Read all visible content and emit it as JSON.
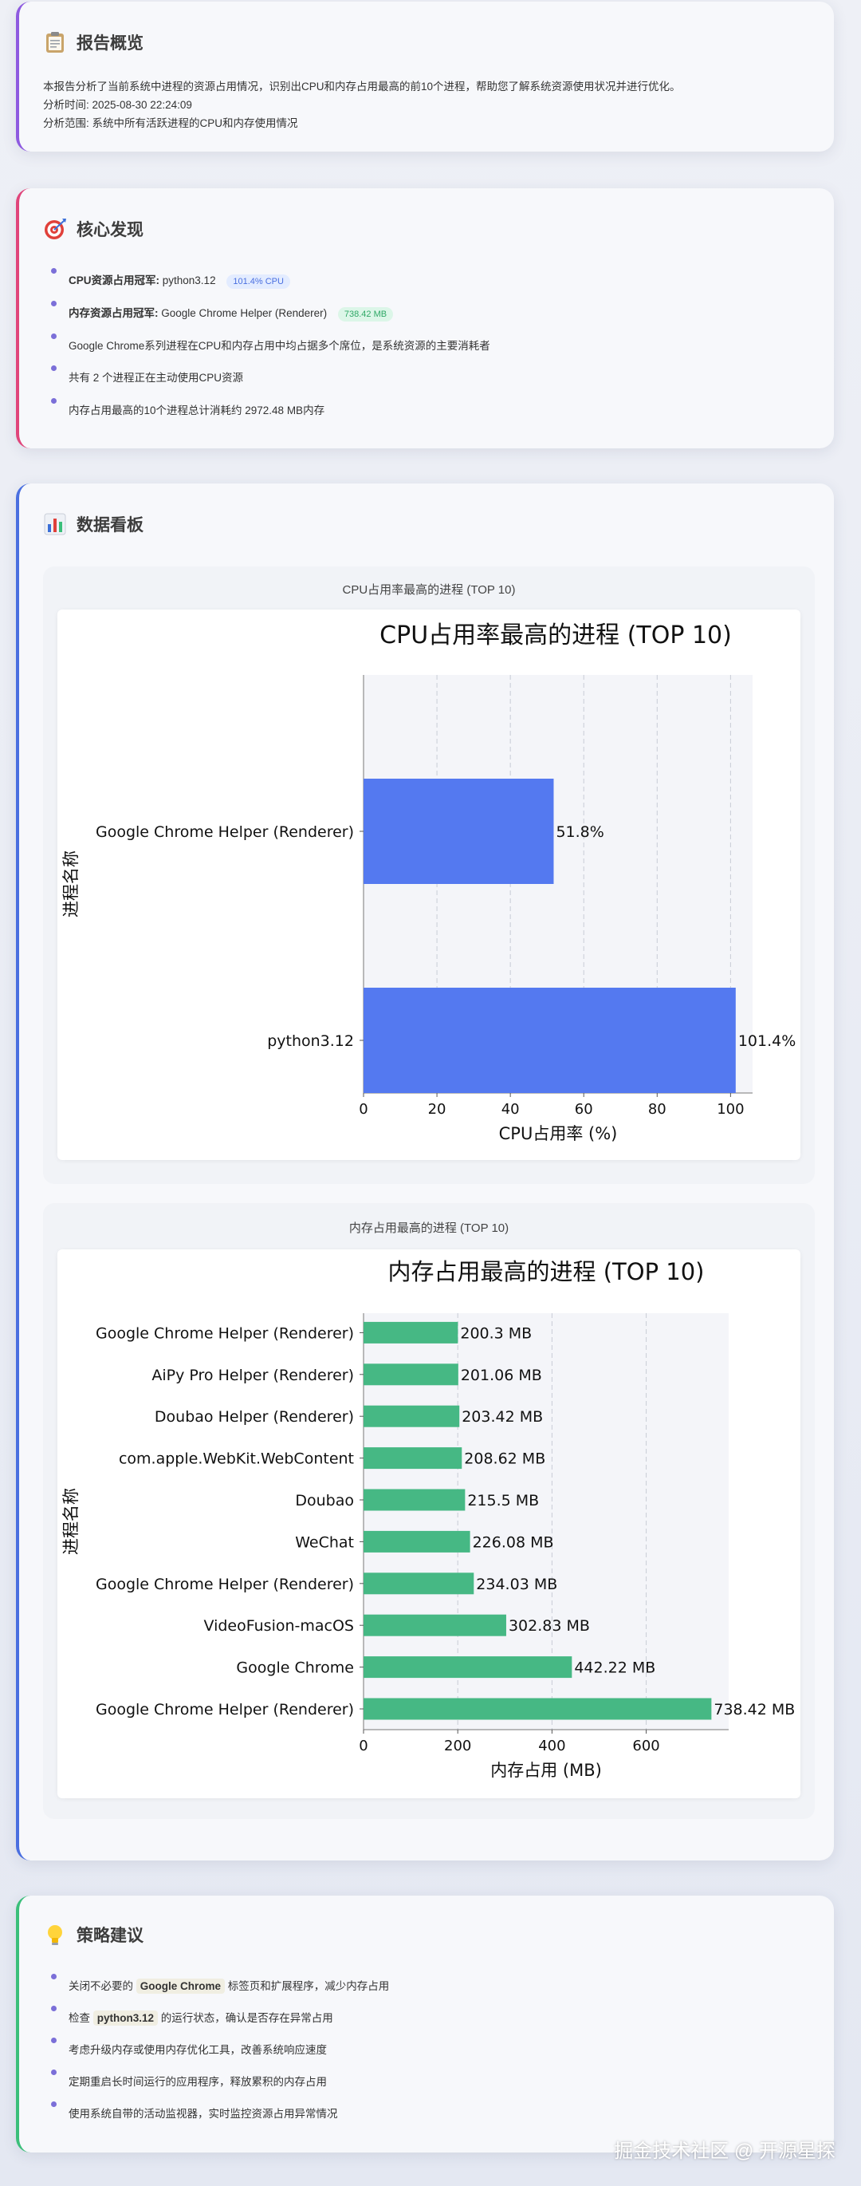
{
  "overview": {
    "title": "报告概览",
    "desc": "本报告分析了当前系统中进程的资源占用情况，识别出CPU和内存占用最高的前10个进程，帮助您了解系统资源使用状况并进行优化。",
    "time": "分析时间: 2025-08-30 22:24:09",
    "scope": "分析范围: 系统中所有活跃进程的CPU和内存使用情况"
  },
  "findings": {
    "title": "核心发现",
    "cpu_label": "CPU资源占用冠军:",
    "cpu_value": "python3.12",
    "cpu_badge": "101.4% CPU",
    "mem_label": "内存资源占用冠军:",
    "mem_value": "Google Chrome Helper (Renderer)",
    "mem_badge": "738.42 MB",
    "item3": "Google Chrome系列进程在CPU和内存占用中均占据多个席位，是系统资源的主要消耗者",
    "item4": "共有 2 个进程正在主动使用CPU资源",
    "item5": "内存占用最高的10个进程总计消耗约 2972.48 MB内存"
  },
  "dashboard": {
    "title": "数据看板",
    "cpu_caption": "CPU占用率最高的进程 (TOP 10)",
    "mem_caption": "内存占用最高的进程 (TOP 10)"
  },
  "chart_data": [
    {
      "type": "bar",
      "orientation": "horizontal",
      "title": "CPU占用率最高的进程 (TOP 10)",
      "xlabel": "CPU占用率 (%)",
      "ylabel": "进程名称",
      "categories": [
        "python3.12",
        "Google Chrome Helper (Renderer)"
      ],
      "values": [
        101.4,
        51.8
      ],
      "value_labels": [
        "101.4%",
        "51.8%"
      ],
      "xlim": [
        0,
        106
      ],
      "xticks": [
        0,
        20,
        40,
        60,
        80,
        100
      ],
      "grid": "vertical-dashed",
      "color": "#5479f0"
    },
    {
      "type": "bar",
      "orientation": "horizontal",
      "title": "内存占用最高的进程 (TOP 10)",
      "xlabel": "内存占用 (MB)",
      "ylabel": "进程名称",
      "categories": [
        "Google Chrome Helper (Renderer)",
        "Google Chrome",
        "VideoFusion-macOS",
        "Google Chrome Helper (Renderer)",
        "WeChat",
        "Doubao",
        "com.apple.WebKit.WebContent",
        "Doubao Helper (Renderer)",
        "AiPy Pro Helper (Renderer)",
        "Google Chrome Helper (Renderer)"
      ],
      "values": [
        738.42,
        442.22,
        302.83,
        234.03,
        226.08,
        215.5,
        208.62,
        203.42,
        201.06,
        200.3
      ],
      "value_labels": [
        "738.42 MB",
        "442.22 MB",
        "302.83 MB",
        "234.03 MB",
        "226.08 MB",
        "215.5 MB",
        "208.62 MB",
        "203.42 MB",
        "201.06 MB",
        "200.3 MB"
      ],
      "xlim": [
        0,
        775
      ],
      "xticks": [
        0,
        200,
        400,
        600
      ],
      "grid": "vertical-dashed",
      "color": "#46b884"
    }
  ],
  "strategy": {
    "title": "策略建议",
    "s1_pre": "关闭不必要的 ",
    "s1_chip": "Google Chrome",
    "s1_post": " 标签页和扩展程序，减少内存占用",
    "s2_pre": "检查 ",
    "s2_chip": "python3.12",
    "s2_post": " 的运行状态，确认是否存在异常占用",
    "s3": "考虑升级内存或使用内存优化工具，改善系统响应速度",
    "s4": "定期重启长时间运行的应用程序，释放累积的内存占用",
    "s5": "使用系统自带的活动监视器，实时监控资源占用异常情况"
  },
  "watermark": "掘金技术社区 @ 开源星探",
  "colors": {
    "overview_accent": "#8e5ae0",
    "findings_accent": "#e0457b",
    "dashboard_accent": "#4a6fe0",
    "strategy_accent": "#3bbf7a",
    "cpu_bar": "#5479f0",
    "mem_bar": "#46b884"
  }
}
